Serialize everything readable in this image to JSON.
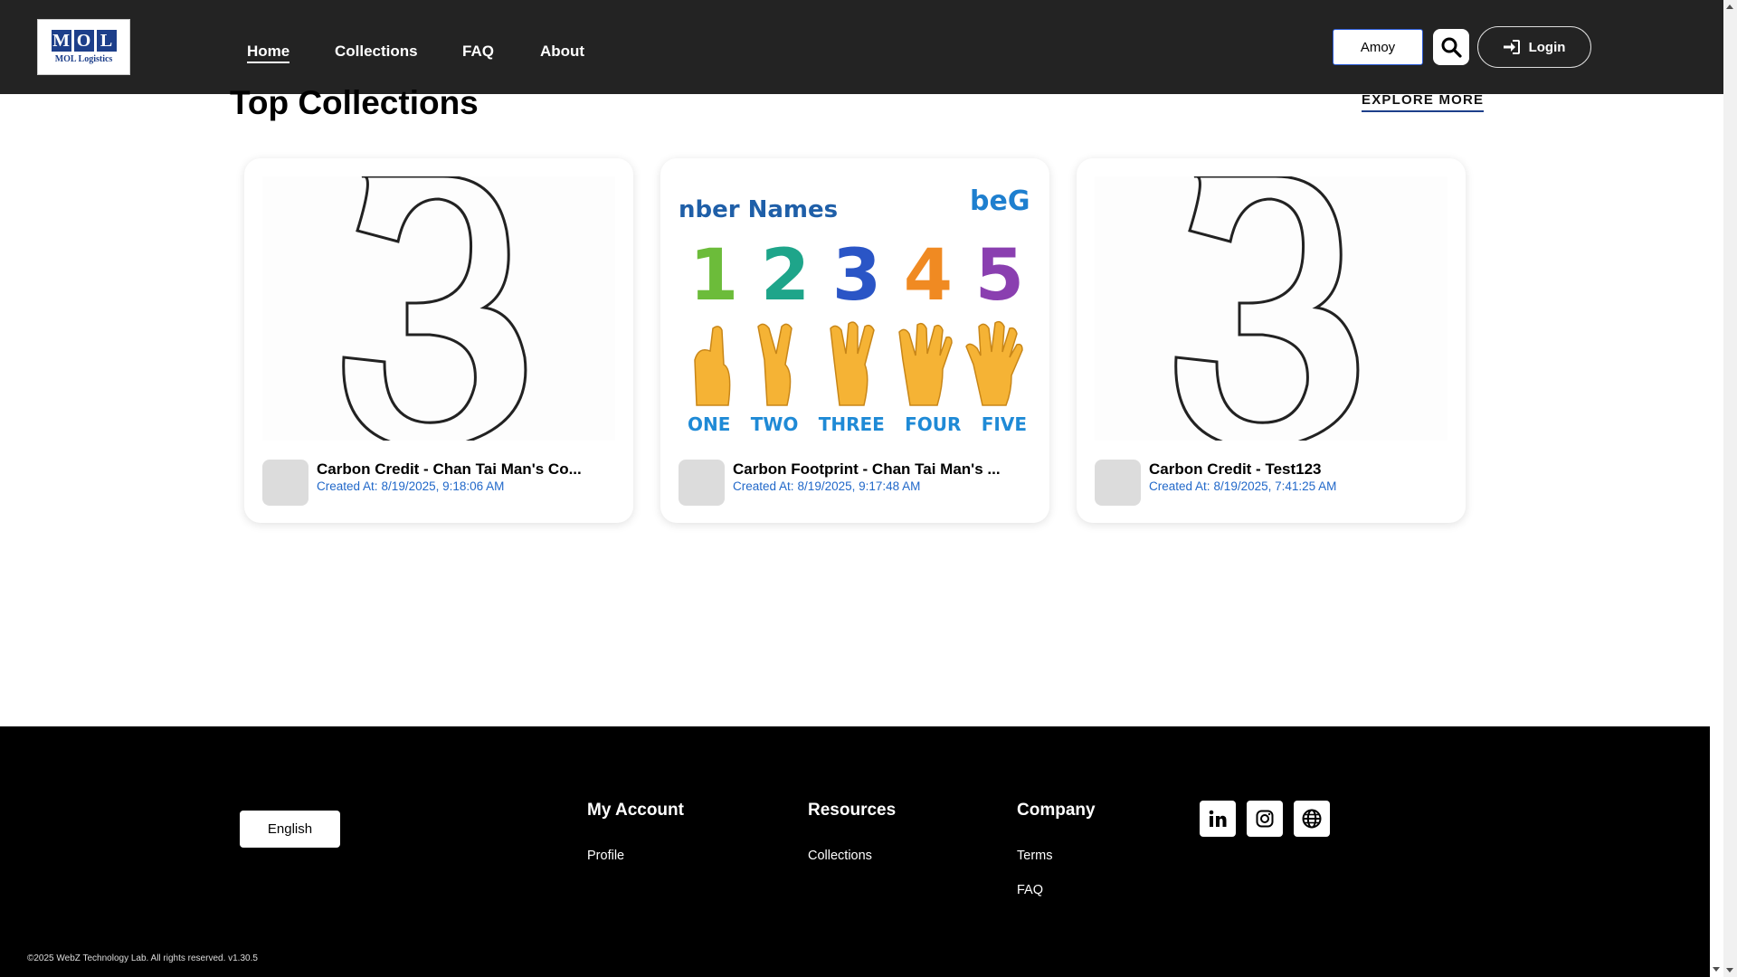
{
  "header": {
    "logo": {
      "letters": [
        "M",
        "O",
        "L"
      ],
      "subtitle": "MOL Logistics"
    },
    "nav": [
      {
        "label": "Home",
        "active": true
      },
      {
        "label": "Collections",
        "active": false
      },
      {
        "label": "FAQ",
        "active": false
      },
      {
        "label": "About",
        "active": false
      }
    ],
    "chain_selector": "Amoy",
    "search_icon": "search-icon",
    "login_label": "Login",
    "login_icon": "login-icon"
  },
  "main": {
    "section_title": "Top Collections",
    "explore_more": "EXPLORE MORE",
    "cards": [
      {
        "title": "Carbon Credit - Chan Tai Man's Co...",
        "created_label": "Created At:",
        "created_at": "8/19/2025, 9:18:06 AM",
        "image": "number-three-outline"
      },
      {
        "title": "Carbon Footprint - Chan Tai Man's ...",
        "created_label": "Created At:",
        "created_at": "8/19/2025, 9:17:48 AM",
        "image": "number-names-chart",
        "image_text": {
          "heading": "nber Names",
          "brand": "beG",
          "digits": [
            "1",
            "2",
            "3",
            "4",
            "5"
          ],
          "words": [
            "ONE",
            "TWO",
            "THREE",
            "FOUR",
            "FIVE"
          ]
        }
      },
      {
        "title": "Carbon Credit - Test123",
        "created_label": "Created At:",
        "created_at": "8/19/2025, 7:41:25 AM",
        "image": "number-three-outline"
      }
    ]
  },
  "footer": {
    "language": "English",
    "columns": [
      {
        "title": "My Account",
        "links": [
          "Profile"
        ]
      },
      {
        "title": "Resources",
        "links": [
          "Collections"
        ]
      },
      {
        "title": "Company",
        "links": [
          "Terms",
          "FAQ"
        ]
      }
    ],
    "social_icons": [
      "linkedin-icon",
      "instagram-icon",
      "globe-icon"
    ],
    "copyright": "©2025 WebZ Technology Lab. All rights reserved. v1.30.5"
  },
  "colors": {
    "header_bg": "#232323",
    "footer_bg": "#000000",
    "link_blue": "#2168c9",
    "logo_blue": "#1d3f8a"
  }
}
